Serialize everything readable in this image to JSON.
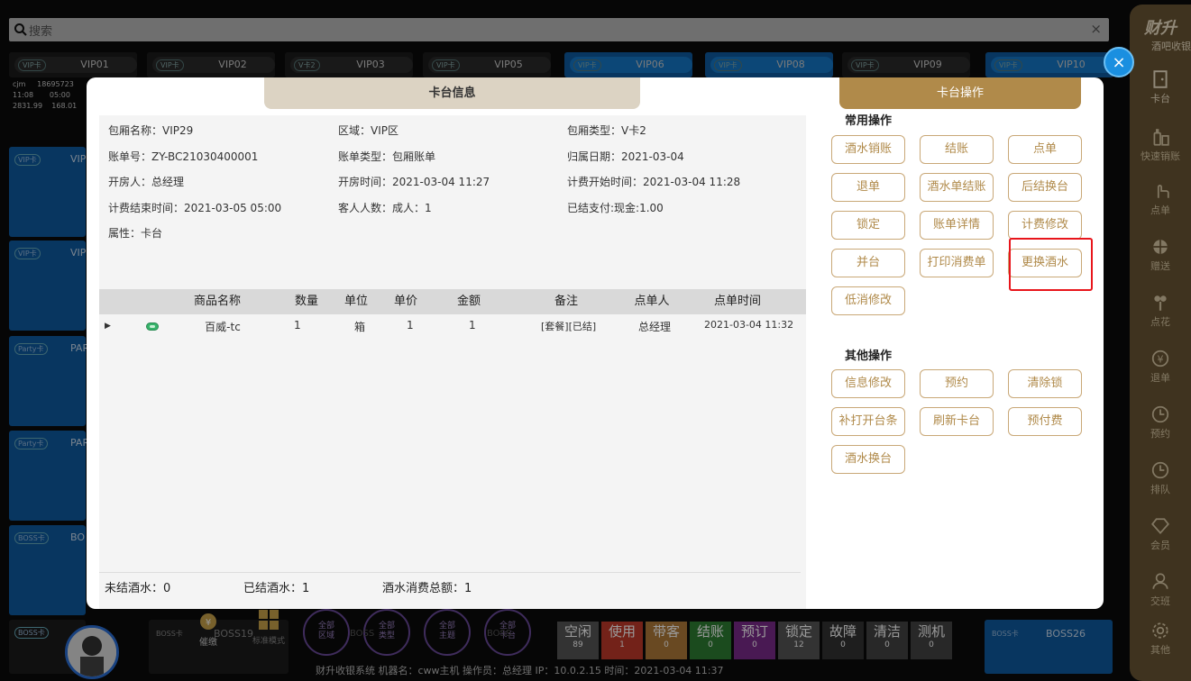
{
  "search": {
    "placeholder": "搜索",
    "clear": "×"
  },
  "top_rooms": [
    {
      "tag": "VIP卡",
      "name": "VIP01"
    },
    {
      "tag": "VIP卡",
      "name": "VIP02"
    },
    {
      "tag": "V卡2",
      "name": "VIP03"
    },
    {
      "tag": "VIP卡",
      "name": "VIP05"
    },
    {
      "tag": "VIP卡",
      "name": "VIP06"
    },
    {
      "tag": "VIP卡",
      "name": "VIP08"
    },
    {
      "tag": "VIP卡",
      "name": "VIP09"
    },
    {
      "tag": "VIP卡",
      "name": "VIP10"
    }
  ],
  "mini_info": {
    "l1a": "cjm",
    "l1b": "18695723",
    "l2a": "11:08",
    "l2b": "05:00",
    "l3a": "2831.99",
    "l3b": "168.01"
  },
  "left_rooms": [
    {
      "tag": "VIP卡",
      "name": "VIP"
    },
    {
      "tag": "VIP卡",
      "name": "VIP"
    },
    {
      "tag": "Party卡",
      "name": "PAR"
    },
    {
      "tag": "Party卡",
      "name": "PAR"
    },
    {
      "tag": "BOSS卡",
      "name": "BO"
    }
  ],
  "bottom_rooms": {
    "left_tag": "BOSS卡",
    "mid_tag": "BOSS卡",
    "mid_name": "BOSS19",
    "right_tag": "BOSS卡",
    "right_name": "BOSS26"
  },
  "rail": {
    "brand": "财升",
    "subtitle": "酒吧收银",
    "items": [
      {
        "label": "卡台",
        "icon": "door-icon"
      },
      {
        "label": "快速销账",
        "icon": "bottle-icon"
      },
      {
        "label": "点单",
        "icon": "hand-icon"
      },
      {
        "label": "赠送",
        "icon": "gift-icon"
      },
      {
        "label": "点花",
        "icon": "flower-icon"
      },
      {
        "label": "退单",
        "icon": "yen-icon"
      },
      {
        "label": "预约",
        "icon": "clock-icon"
      },
      {
        "label": "排队",
        "icon": "queue-icon"
      },
      {
        "label": "会员",
        "icon": "diamond-icon"
      },
      {
        "label": "交班",
        "icon": "person-icon"
      },
      {
        "label": "其他",
        "icon": "gear-icon"
      }
    ]
  },
  "bottom": {
    "urge": "催缴",
    "mode": "标准模式",
    "filters": [
      {
        "l1": "全部",
        "l2": "区域"
      },
      {
        "l1": "全部",
        "l2": "类型"
      },
      {
        "l1": "全部",
        "l2": "主题"
      },
      {
        "l1": "全部",
        "l2": "卡台"
      }
    ],
    "filter_bg": [
      "BOSS",
      "BOSS"
    ],
    "statuses": [
      {
        "label": "空闲",
        "count": "89",
        "color": "#555555"
      },
      {
        "label": "使用",
        "count": "1",
        "color": "#c0392b"
      },
      {
        "label": "带客",
        "count": "0",
        "color": "#b07a3a"
      },
      {
        "label": "结账",
        "count": "0",
        "color": "#2e7d32"
      },
      {
        "label": "预订",
        "count": "0",
        "color": "#7b2a8a"
      },
      {
        "label": "锁定",
        "count": "12",
        "color": "#555555"
      },
      {
        "label": "故障",
        "count": "0",
        "color": "#333333"
      },
      {
        "label": "清洁",
        "count": "0",
        "color": "#444444"
      },
      {
        "label": "测机",
        "count": "0",
        "color": "#444444"
      }
    ],
    "info": "财升收银系统    机器名：cww主机    操作员：总经理    IP：10.0.2.15    时间：2021-03-04 11:37"
  },
  "modal": {
    "left_title": "卡台信息",
    "right_title": "卡台操作",
    "info": {
      "room_name": "包厢名称：VIP29",
      "area": "区域：VIP区",
      "room_type": "包厢类型：V卡2",
      "bill_no": "账单号：ZY-BC21030400001",
      "bill_type": "账单类型：包厢账单",
      "belong_date": "归属日期：2021-03-04",
      "opener": "开房人：总经理",
      "open_time": "开房时间：2021-03-04 11:27",
      "charge_start": "计费开始时间：2021-03-04 11:28",
      "charge_end": "计费结束时间：2021-03-05 05:00",
      "guests": "客人人数：成人：1",
      "paid": "已结支付:现金:1.00",
      "attr": "属性：卡台"
    },
    "table": {
      "headers": [
        "商品名称",
        "数量",
        "单位",
        "单价",
        "金额",
        "备注",
        "点单人",
        "点单时间"
      ],
      "rows": [
        {
          "expand": "▶",
          "name": "百威-tc",
          "qty": "1",
          "unit": "箱",
          "price": "1",
          "amount": "1",
          "note": "[套餐][已结]",
          "orderer": "总经理",
          "time": "2021-03-04 11:32"
        }
      ]
    },
    "footer": {
      "unsettled": "未结酒水：0",
      "settled": "已结酒水：1",
      "total": "酒水消费总额：1"
    },
    "common_title": "常用操作",
    "common_ops": [
      "酒水销账",
      "结账",
      "点单",
      "退单",
      "酒水单结账",
      "后结换台",
      "锁定",
      "账单详情",
      "计费修改",
      "并台",
      "打印消费单",
      "更换酒水",
      "低消修改"
    ],
    "other_title": "其他操作",
    "other_ops": [
      "信息修改",
      "预约",
      "清除锁",
      "补打开台条",
      "刷新卡台",
      "预付费",
      "酒水换台"
    ]
  },
  "close": "×"
}
